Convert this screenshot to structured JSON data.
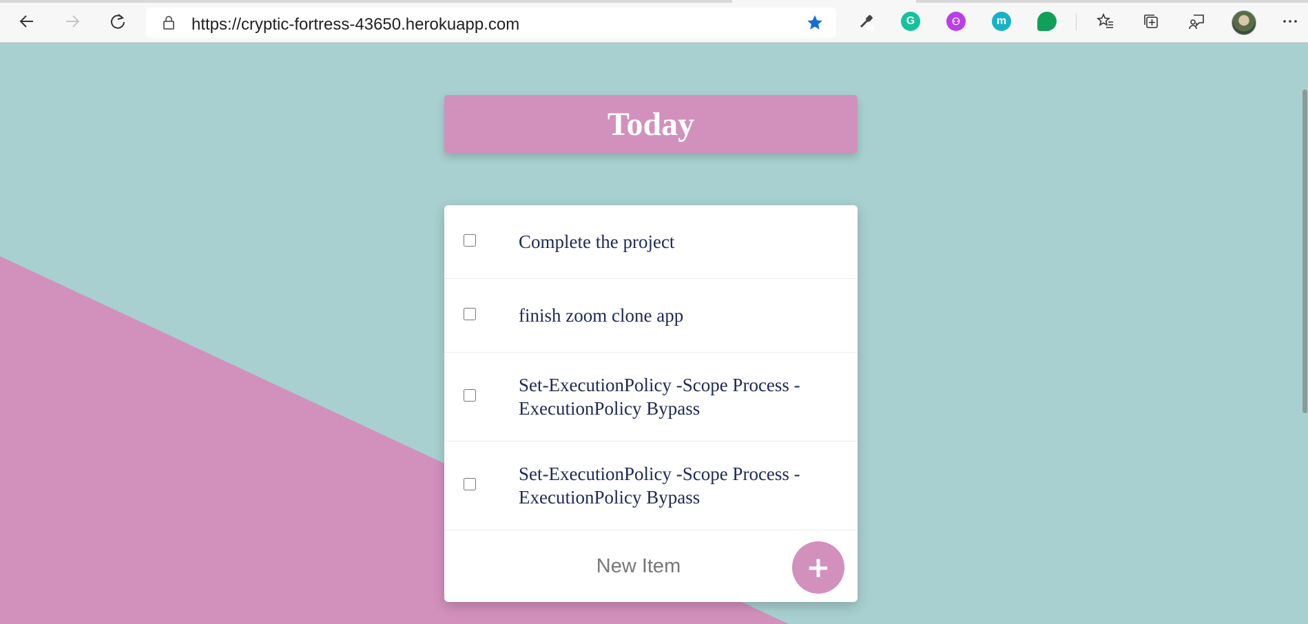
{
  "browser": {
    "url": "https://cryptic-fortress-43650.herokuapp.com",
    "favorite_starred": true,
    "extensions": [
      {
        "name": "eyedropper-icon"
      },
      {
        "name": "grammarly-icon",
        "color": "#15c39a",
        "glyph": "G"
      },
      {
        "name": "purple-extension-icon",
        "color": "#b93ee8",
        "glyph": "⚇"
      },
      {
        "name": "teal-m-extension-icon",
        "color": "#16b3c6",
        "glyph": "m"
      },
      {
        "name": "chat-bubble-extension-icon",
        "color": "#10a05a",
        "glyph": ""
      }
    ],
    "star_color": "#0f6fd6"
  },
  "page": {
    "title": "Today",
    "items": [
      {
        "text": "Complete the project",
        "checked": false
      },
      {
        "text": "finish zoom clone app",
        "checked": false
      },
      {
        "text": "Set-ExecutionPolicy -Scope Process -ExecutionPolicy Bypass",
        "checked": false
      },
      {
        "text": "Set-ExecutionPolicy -Scope Process -ExecutionPolicy Bypass",
        "checked": false
      }
    ],
    "new_item_placeholder": "New Item",
    "add_button_label": "+",
    "colors": {
      "background": "#a8d0d0",
      "accent": "#d291bc",
      "item_text": "#1e2a55"
    }
  }
}
